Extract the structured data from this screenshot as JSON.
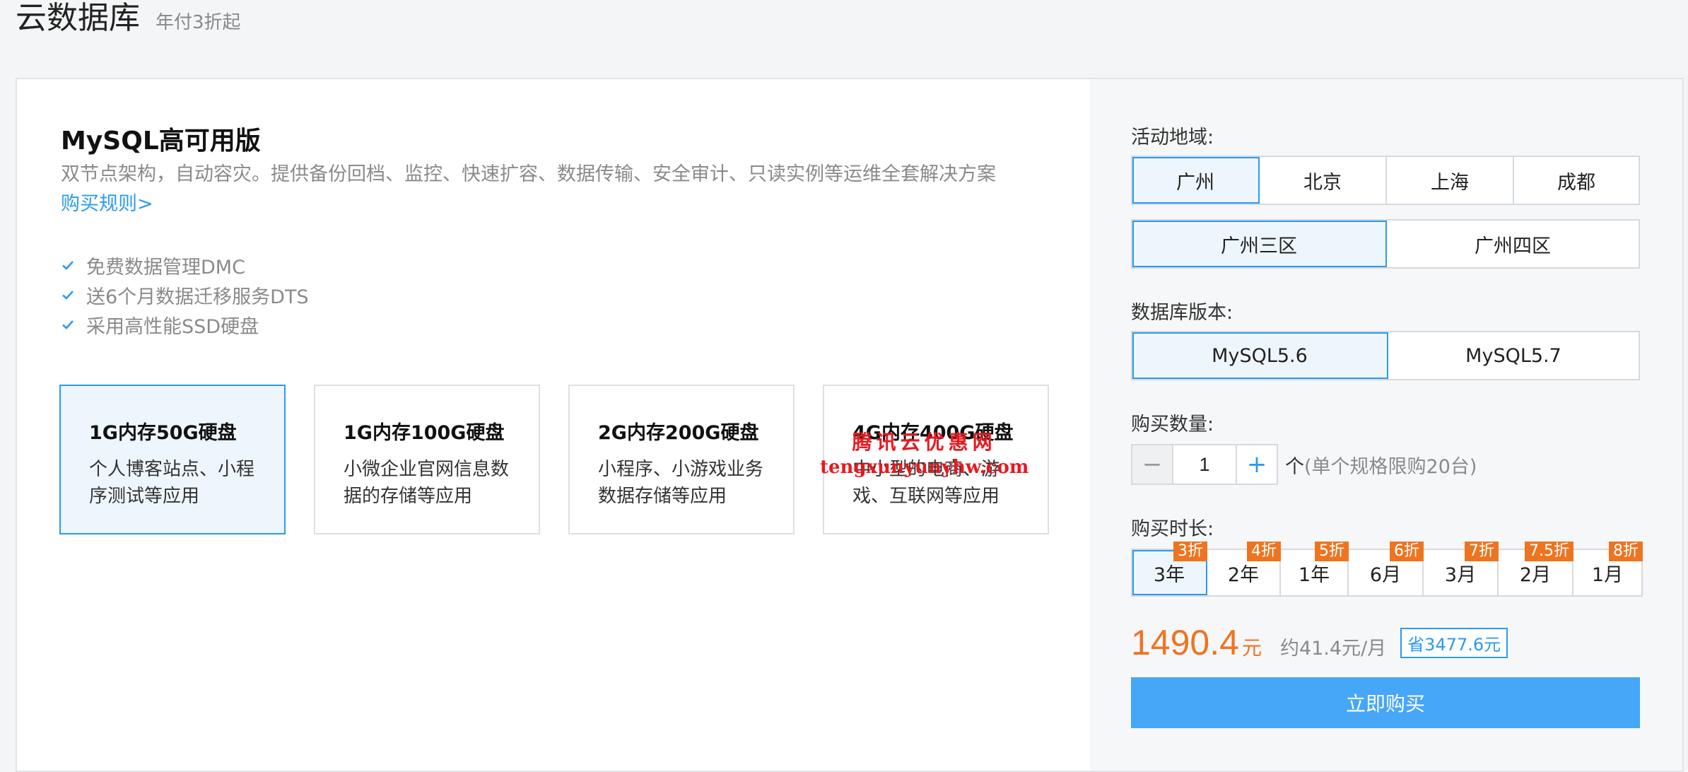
{
  "header": {
    "title": "云数据库",
    "subtitle": "年付3折起"
  },
  "product": {
    "name": "MySQL高可用版",
    "description": "双节点架构，自动容灾。提供备份回档、监控、快速扩容、数据传输、安全审计、只读实例等运维全套解决方案",
    "rules_link": "购买规则>",
    "features": [
      "免费数据管理DMC",
      "送6个月数据迁移服务DTS",
      "采用高性能SSD硬盘"
    ]
  },
  "specs": [
    {
      "title": "1G内存50G硬盘",
      "desc": "个人博客站点、小程序测试等应用",
      "selected": true
    },
    {
      "title": "1G内存100G硬盘",
      "desc": "小微企业官网信息数据的存储等应用",
      "selected": false
    },
    {
      "title": "2G内存200G硬盘",
      "desc": "小程序、小游戏业务数据存储等应用",
      "selected": false
    },
    {
      "title": "4G内存400G硬盘",
      "desc": "中小型的电商、游戏、互联网等应用",
      "selected": false
    }
  ],
  "watermark": {
    "line1": "腾讯云优惠网",
    "line2": "tengxunyunyhw.com"
  },
  "config": {
    "region_label": "活动地域:",
    "regions": [
      "广州",
      "北京",
      "上海",
      "成都"
    ],
    "zones": [
      "广州三区",
      "广州四区"
    ],
    "version_label": "数据库版本:",
    "versions": [
      "MySQL5.6",
      "MySQL5.7"
    ],
    "quantity_label": "购买数量:",
    "quantity_value": "1",
    "quantity_minus": "−",
    "quantity_plus": "+",
    "quantity_unit": "个",
    "quantity_note": "(单个规格限购20台)",
    "duration_label": "购买时长:",
    "durations": [
      {
        "label": "3年",
        "badge": "3折"
      },
      {
        "label": "2年",
        "badge": "4折"
      },
      {
        "label": "1年",
        "badge": "5折"
      },
      {
        "label": "6月",
        "badge": "6折"
      },
      {
        "label": "3月",
        "badge": "7折"
      },
      {
        "label": "2月",
        "badge": "7.5折"
      },
      {
        "label": "1月",
        "badge": "8折"
      }
    ],
    "price": "1490.4",
    "price_unit": "元",
    "monthly": "约41.4元/月",
    "saving": "省3477.6元",
    "buy_button": "立即购买"
  },
  "colors": {
    "accent": "#2b9af0",
    "orange": "#ee7421",
    "button": "#46a6f7"
  }
}
